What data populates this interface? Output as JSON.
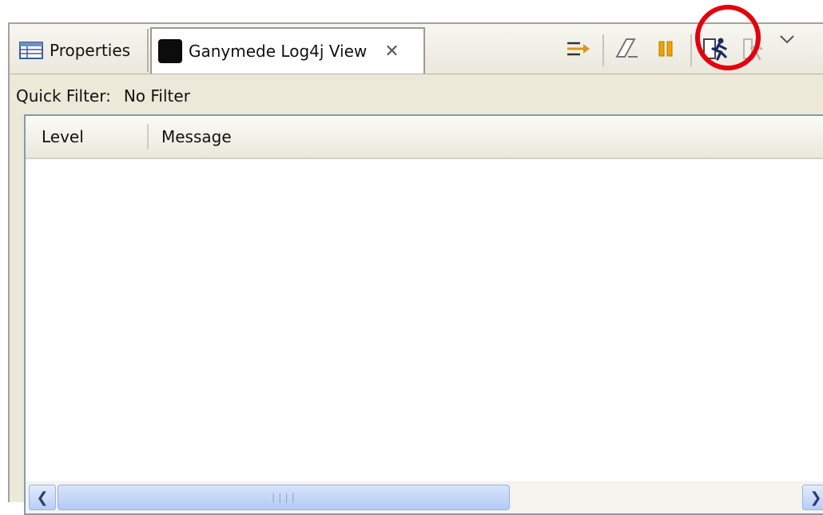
{
  "tabs": [
    {
      "label": "Properties",
      "icon": "properties-table-icon",
      "active": false
    },
    {
      "label": "Ganymede Log4j View",
      "icon": "ganymede-moon-icon",
      "active": true,
      "close_icon": "close-icon"
    }
  ],
  "toolbar": {
    "buttons": [
      {
        "name": "wrap-lines-button",
        "icon": "arrows-right-icon"
      },
      {
        "name": "clear-button",
        "icon": "eraser-icon"
      },
      {
        "name": "pause-button",
        "icon": "pause-icon"
      },
      {
        "name": "start-server-button",
        "icon": "running-man-icon",
        "highlighted": true
      },
      {
        "name": "stop-server-button",
        "icon": "running-man-disabled-icon"
      }
    ],
    "menu_icon": "chevron-down-icon",
    "highlight_color": "#e4000f"
  },
  "quick_filter": {
    "label": "Quick Filter:",
    "value": "No Filter"
  },
  "table": {
    "columns": [
      "Level",
      "Message"
    ],
    "rows": []
  },
  "colors": {
    "panel_bg": "#ece9d8",
    "border_blue": "#7f9db9",
    "scroll_thumb": "#b4cbf5"
  }
}
